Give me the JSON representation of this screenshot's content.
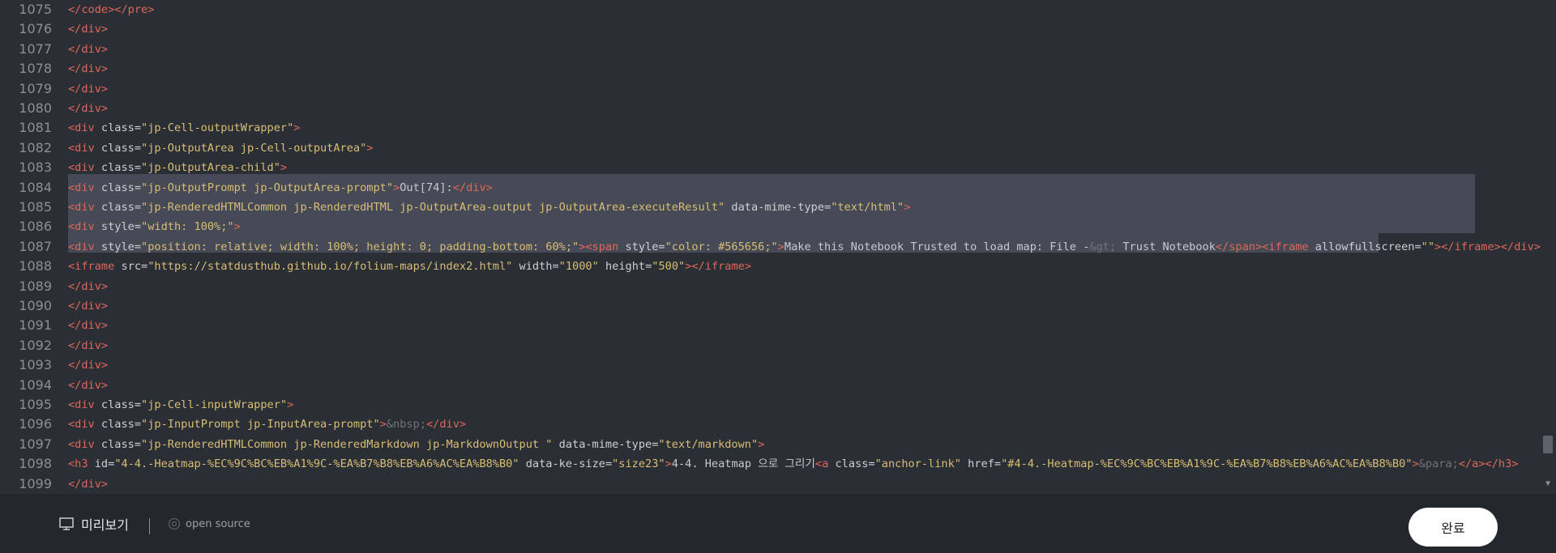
{
  "editor": {
    "lines": [
      {
        "num": "1075",
        "parts": [
          [
            "t",
            "</code></pre>"
          ]
        ]
      },
      {
        "num": "1076",
        "parts": [
          [
            "t",
            "</div>"
          ]
        ]
      },
      {
        "num": "1077",
        "parts": [
          [
            "t",
            "</div>"
          ]
        ]
      },
      {
        "num": "1078",
        "parts": [
          [
            "t",
            "</div>"
          ]
        ]
      },
      {
        "num": "1079",
        "parts": [
          [
            "t",
            "</div>"
          ]
        ]
      },
      {
        "num": "1080",
        "parts": [
          [
            "t",
            "</div>"
          ]
        ]
      },
      {
        "num": "1081",
        "parts": [
          [
            "t",
            "<div "
          ],
          [
            "a",
            "class="
          ],
          [
            "s",
            "\"jp-Cell-outputWrapper\""
          ],
          [
            "t",
            ">"
          ]
        ]
      },
      {
        "num": "1082",
        "parts": [
          [
            "t",
            "<div "
          ],
          [
            "a",
            "class="
          ],
          [
            "s",
            "\"jp-OutputArea jp-Cell-outputArea\""
          ],
          [
            "t",
            ">"
          ]
        ]
      },
      {
        "num": "1083",
        "parts": [
          [
            "t",
            "<div "
          ],
          [
            "a",
            "class="
          ],
          [
            "s",
            "\"jp-OutputArea-child\""
          ],
          [
            "t",
            ">"
          ]
        ]
      },
      {
        "num": "1084",
        "parts": [
          [
            "t",
            "<div "
          ],
          [
            "a",
            "class="
          ],
          [
            "s",
            "\"jp-OutputPrompt jp-OutputArea-prompt\""
          ],
          [
            "t",
            ">"
          ],
          [
            "x",
            "Out[74]:"
          ],
          [
            "t",
            "</div>"
          ]
        ]
      },
      {
        "num": "1085",
        "parts": [
          [
            "t",
            "<div "
          ],
          [
            "a",
            "class="
          ],
          [
            "s",
            "\"jp-RenderedHTMLCommon jp-RenderedHTML jp-OutputArea-output jp-OutputArea-executeResult\""
          ],
          [
            "a",
            " data-mime-type="
          ],
          [
            "s",
            "\"text/html\""
          ],
          [
            "t",
            ">"
          ]
        ]
      },
      {
        "num": "1086",
        "parts": [
          [
            "t",
            "<div "
          ],
          [
            "a",
            "style="
          ],
          [
            "s",
            "\"width: 100%;\""
          ],
          [
            "t",
            ">"
          ]
        ]
      },
      {
        "num": "1087",
        "parts": [
          [
            "t",
            "<div "
          ],
          [
            "a",
            "style="
          ],
          [
            "s",
            "\"position: relative; width: 100%; height: 0; padding-bottom: 60%;\""
          ],
          [
            "t",
            "><span "
          ],
          [
            "a",
            "style="
          ],
          [
            "s",
            "\"color: #565656;\""
          ],
          [
            "t",
            ">"
          ],
          [
            "x",
            "Make this Notebook Trusted to load map: File -"
          ],
          [
            "e",
            "&gt;"
          ],
          [
            "x",
            " Trust Notebook"
          ],
          [
            "t",
            "</span><iframe "
          ],
          [
            "a",
            "allowfullscreen="
          ],
          [
            "s",
            "\"\""
          ],
          [
            "t",
            "></iframe></div>"
          ]
        ]
      },
      {
        "num": "1088",
        "parts": [
          [
            "t",
            "<iframe "
          ],
          [
            "a",
            "src="
          ],
          [
            "s",
            "\"https://statdusthub.github.io/folium-maps/index2.html\""
          ],
          [
            "a",
            " width="
          ],
          [
            "s",
            "\"1000\""
          ],
          [
            "a",
            " height="
          ],
          [
            "s",
            "\"500\""
          ],
          [
            "t",
            "></iframe>"
          ]
        ]
      },
      {
        "num": "1089",
        "parts": [
          [
            "t",
            "</div>"
          ]
        ]
      },
      {
        "num": "1090",
        "parts": [
          [
            "t",
            "</div>"
          ]
        ]
      },
      {
        "num": "1091",
        "parts": [
          [
            "t",
            "</div>"
          ]
        ]
      },
      {
        "num": "1092",
        "parts": [
          [
            "t",
            "</div>"
          ]
        ]
      },
      {
        "num": "1093",
        "parts": [
          [
            "t",
            "</div>"
          ]
        ]
      },
      {
        "num": "1094",
        "parts": [
          [
            "t",
            "</div>"
          ]
        ]
      },
      {
        "num": "1095",
        "parts": [
          [
            "t",
            "<div "
          ],
          [
            "a",
            "class="
          ],
          [
            "s",
            "\"jp-Cell-inputWrapper\""
          ],
          [
            "t",
            ">"
          ]
        ]
      },
      {
        "num": "1096",
        "parts": [
          [
            "t",
            "<div "
          ],
          [
            "a",
            "class="
          ],
          [
            "s",
            "\"jp-InputPrompt jp-InputArea-prompt\""
          ],
          [
            "t",
            ">"
          ],
          [
            "e",
            "&nbsp;"
          ],
          [
            "t",
            "</div>"
          ]
        ]
      },
      {
        "num": "1097",
        "parts": [
          [
            "t",
            "<div "
          ],
          [
            "a",
            "class="
          ],
          [
            "s",
            "\"jp-RenderedHTMLCommon jp-RenderedMarkdown jp-MarkdownOutput \""
          ],
          [
            "a",
            " data-mime-type="
          ],
          [
            "s",
            "\"text/markdown\""
          ],
          [
            "t",
            ">"
          ]
        ]
      },
      {
        "num": "1098",
        "parts": [
          [
            "t",
            "<h3 "
          ],
          [
            "a",
            "id="
          ],
          [
            "s",
            "\"4-4.-Heatmap-%EC%9C%BC%EB%A1%9C-%EA%B7%B8%EB%A6%AC%EA%B8%B0\""
          ],
          [
            "a",
            " data-ke-size="
          ],
          [
            "s",
            "\"size23\""
          ],
          [
            "t",
            ">"
          ],
          [
            "x",
            "4-4. Heatmap 으로 그리기"
          ],
          [
            "t",
            "<a "
          ],
          [
            "a",
            "class="
          ],
          [
            "s",
            "\"anchor-link\""
          ],
          [
            "a",
            " href="
          ],
          [
            "s",
            "\"#4-4.-Heatmap-%EC%9C%BC%EB%A1%9C-%EA%B7%B8%EB%A6%AC%EA%B8%B0\""
          ],
          [
            "t",
            ">"
          ],
          [
            "e",
            "&para;"
          ],
          [
            "t",
            "</a></h3>"
          ]
        ]
      },
      {
        "num": "1099",
        "parts": [
          [
            "t",
            "</div>"
          ]
        ]
      }
    ]
  },
  "footer": {
    "preview_label": "미리보기",
    "open_source_label": "open source",
    "done_label": "완료"
  }
}
